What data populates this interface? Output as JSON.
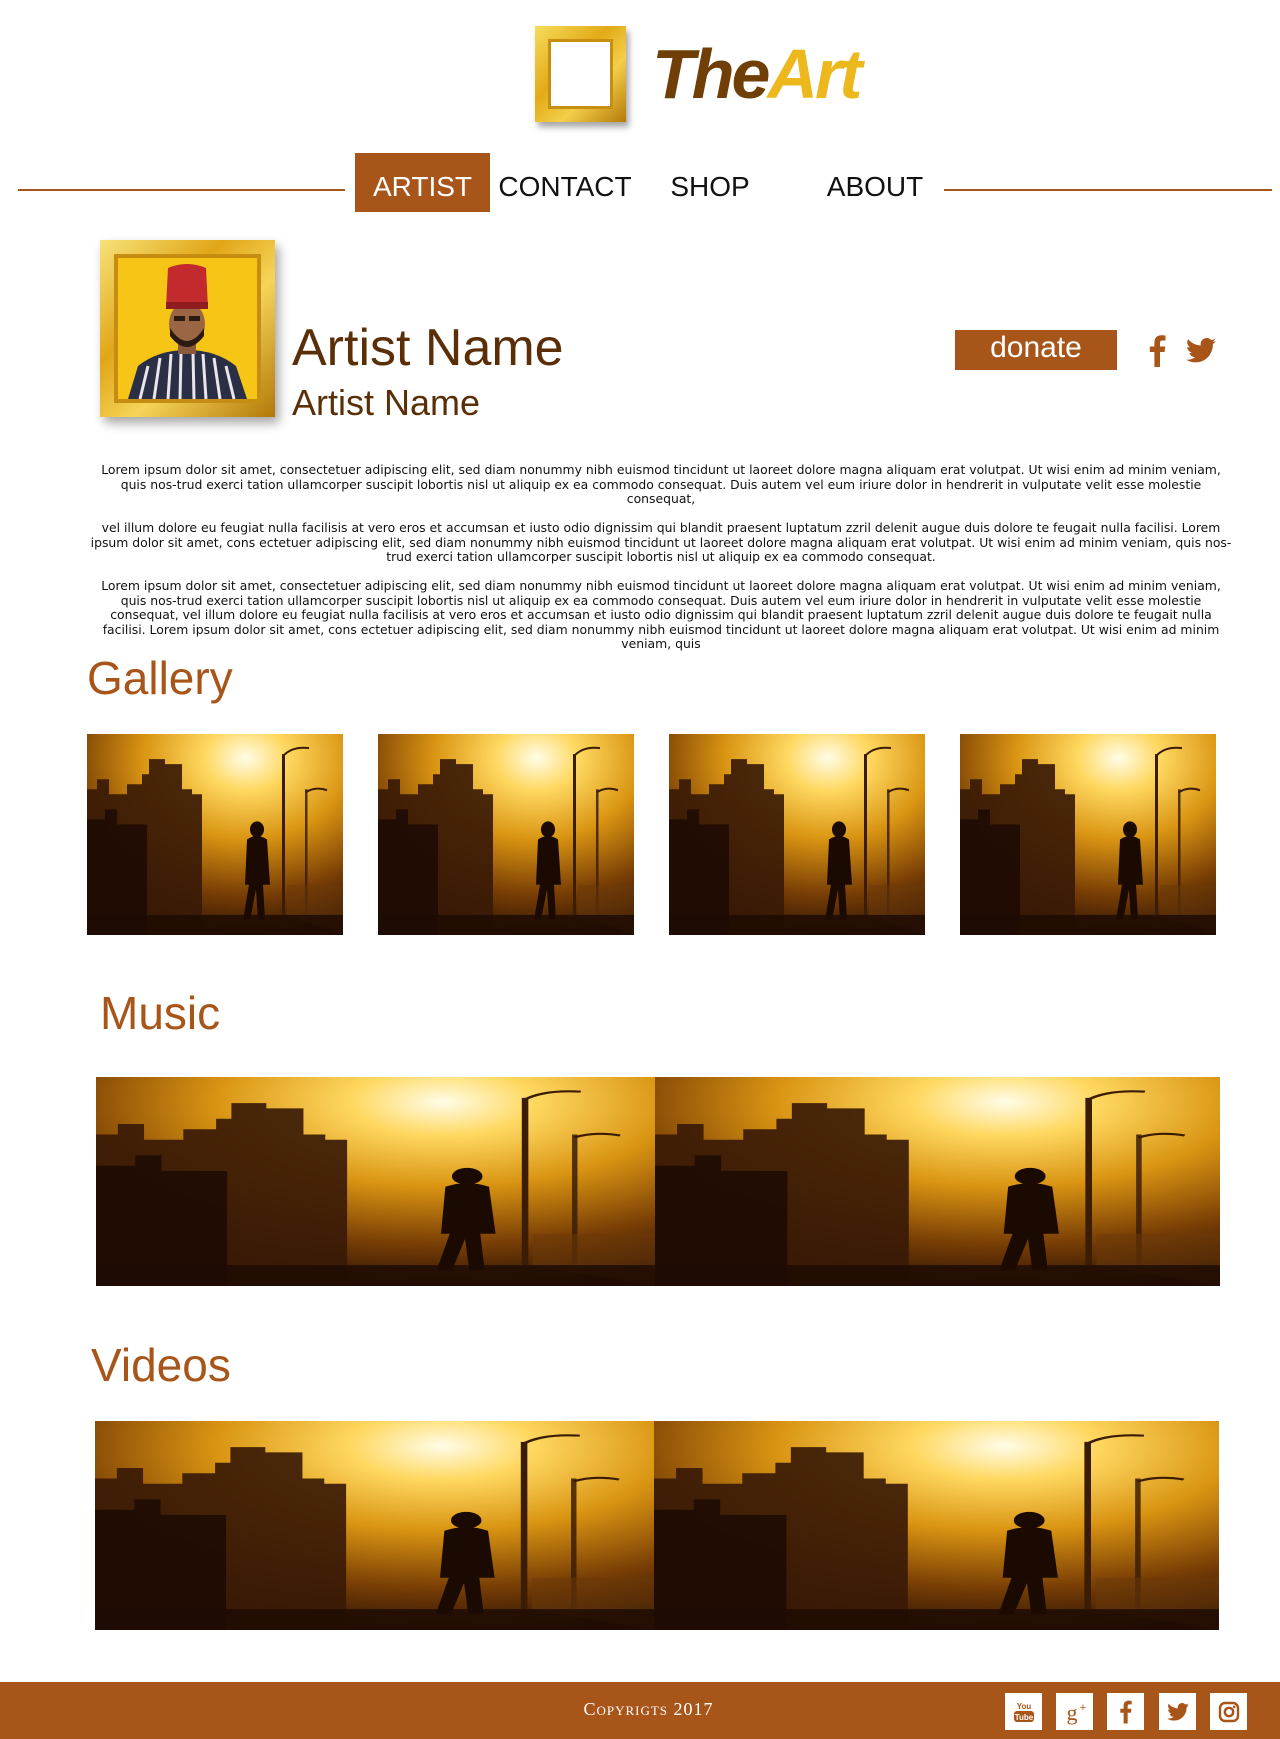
{
  "brand": {
    "the": "The",
    "art": "Art"
  },
  "nav": {
    "items": [
      {
        "label": "ARTIST",
        "active": true
      },
      {
        "label": "CONTACT",
        "active": false
      },
      {
        "label": "SHOP",
        "active": false
      },
      {
        "label": "ABOUT",
        "active": false
      }
    ]
  },
  "artist": {
    "name": "Artist Name",
    "subtitle": "Artist Name",
    "donate_label": "donate"
  },
  "social_top": [
    "facebook-icon",
    "twitter-icon"
  ],
  "bio": {
    "paragraphs": [
      "Lorem ipsum dolor sit amet, consectetuer adipiscing elit, sed diam nonummy nibh euismod tincidunt ut laoreet dolore magna aliquam erat volutpat. Ut wisi enim ad minim veniam, quis nos-trud exerci tation ullamcorper suscipit lobortis nisl ut aliquip ex ea commodo consequat. Duis autem vel eum iriure dolor in hendrerit in vulputate velit esse molestie consequat,",
      "vel illum dolore eu feugiat nulla facilisis at vero eros et accumsan et iusto odio dignissim qui blandit praesent luptatum zzril delenit augue duis dolore te feugait nulla facilisi. Lorem ipsum dolor sit amet, cons ectetuer adipiscing elit, sed diam nonummy nibh euismod tincidunt ut laoreet dolore magna aliquam erat volutpat. Ut wisi enim ad minim veniam, quis nos-trud exerci tation ullamcorper suscipit lobortis nisl ut aliquip ex ea commodo consequat.",
      "Lorem ipsum dolor sit amet, consectetuer adipiscing elit, sed diam nonummy nibh euismod tincidunt ut laoreet dolore magna aliquam erat volutpat. Ut wisi enim ad minim veniam, quis nos-trud exerci tation ullamcorper suscipit lobortis nisl ut aliquip ex ea commodo consequat. Duis autem vel eum iriure dolor in hendrerit in vulputate velit esse molestie consequat, vel illum dolore eu feugiat nulla facilisis at vero eros et accumsan et iusto odio dignissim qui blandit praesent luptatum zzril delenit augue duis dolore te feugait nulla facilisi. Lorem ipsum dolor sit amet, cons ectetuer adipiscing elit, sed diam nonummy nibh euismod tincidunt ut laoreet dolore magna aliquam erat volutpat. Ut wisi enim ad minim veniam, quis"
    ]
  },
  "sections": {
    "gallery": "Gallery",
    "music": "Music",
    "videos": "Videos"
  },
  "footer": {
    "copyright": "Copyrigts 2017",
    "social": [
      "youtube-icon",
      "google-plus-icon",
      "facebook-icon",
      "twitter-icon",
      "instagram-icon"
    ]
  },
  "colors": {
    "accent": "#a8551a",
    "heading": "#5a2f08",
    "gold": "#edb81c"
  }
}
